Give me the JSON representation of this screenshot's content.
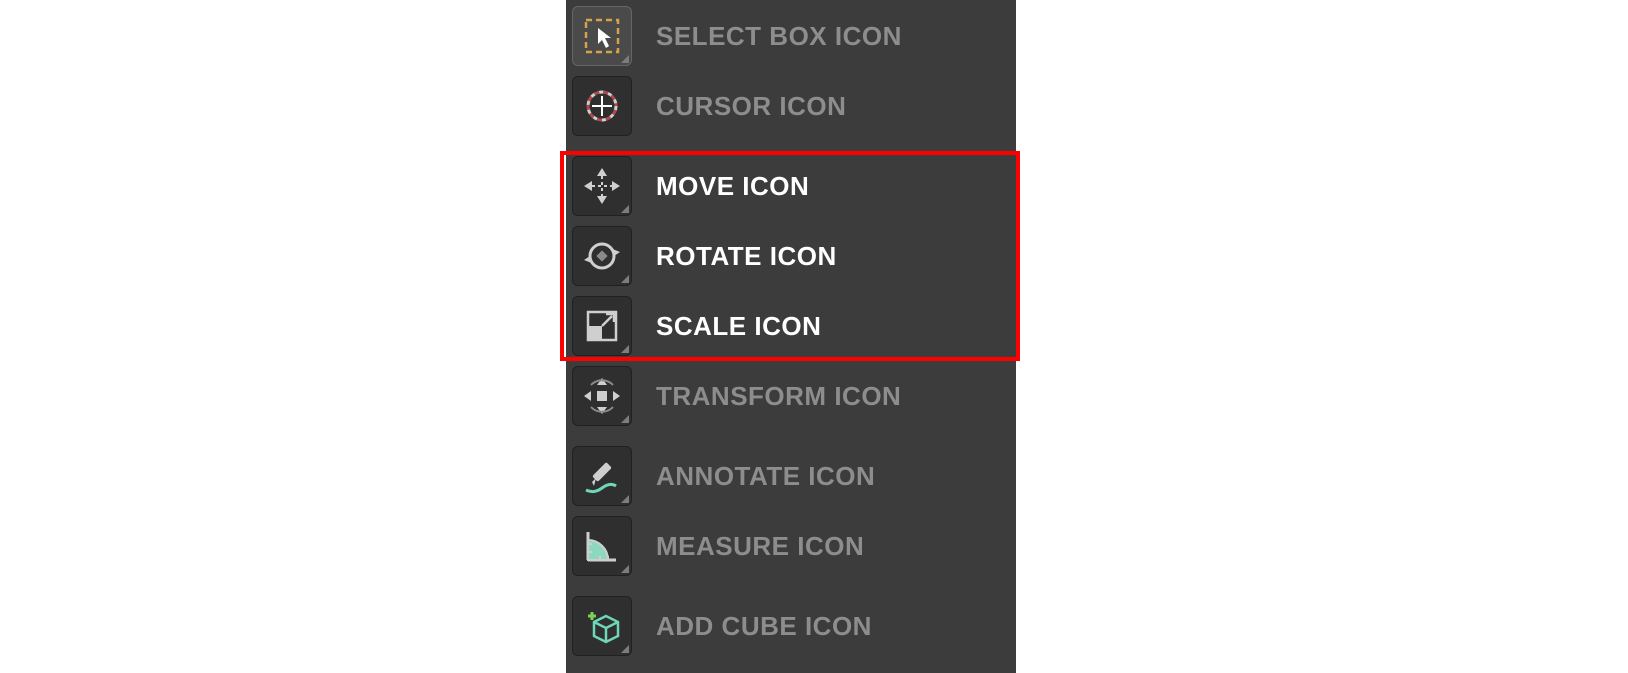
{
  "toolbar": {
    "items": [
      {
        "id": "select-box",
        "label": "SELECT BOX ICON",
        "emph": false,
        "selected": true
      },
      {
        "id": "cursor",
        "label": "CURSOR ICON",
        "emph": false,
        "selected": false
      },
      {
        "id": "move",
        "label": "MOVE ICON",
        "emph": true,
        "selected": false
      },
      {
        "id": "rotate",
        "label": "ROTATE ICON",
        "emph": true,
        "selected": false
      },
      {
        "id": "scale",
        "label": "SCALE ICON",
        "emph": true,
        "selected": false
      },
      {
        "id": "transform",
        "label": "TRANSFORM ICON",
        "emph": false,
        "selected": false
      },
      {
        "id": "annotate",
        "label": "ANNOTATE ICON",
        "emph": false,
        "selected": false
      },
      {
        "id": "measure",
        "label": "MEASURE ICON",
        "emph": false,
        "selected": false
      },
      {
        "id": "add-cube",
        "label": "ADD CUBE ICON",
        "emph": false,
        "selected": false
      }
    ]
  },
  "highlight": {
    "target_ids": [
      "move",
      "rotate",
      "scale"
    ],
    "color": "#ff0000"
  }
}
